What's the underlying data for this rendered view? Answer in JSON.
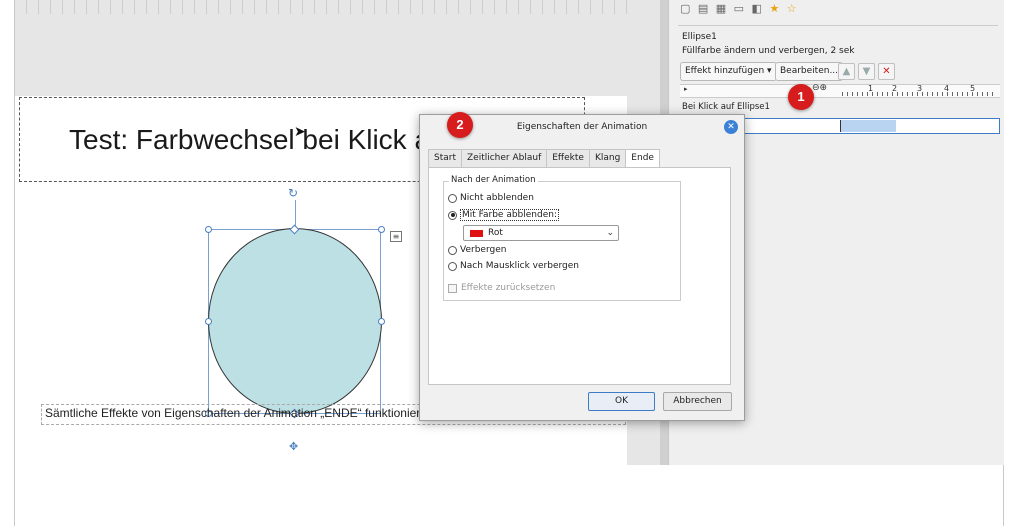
{
  "slide": {
    "title": "Test: Farbwechsel bei Klick auf Ellipse",
    "footer": "Sämtliche Effekte von Eigenschaften der Animation „ENDE“ funktionieren nicht"
  },
  "sidebar": {
    "shape_name": "Ellipse1",
    "effect_desc": "Füllfarbe ändern und verbergen, 2 sek",
    "add_effect_label": "Effekt hinzufügen ▾",
    "edit_label": "Bearbeiten...",
    "trigger_label": "Bei Klick auf Ellipse1",
    "timeline_ticks": [
      "1",
      "2",
      "3",
      "4",
      "5"
    ]
  },
  "badges": {
    "one": "1",
    "two": "2"
  },
  "dialog": {
    "title": "Eigenschaften der Animation",
    "tabs": [
      "Start",
      "Zeitlicher Ablauf",
      "Effekte",
      "Klang",
      "Ende"
    ],
    "active_tab": "Ende",
    "group_label": "Nach der Animation",
    "options": {
      "nicht_abblenden": "Nicht abblenden",
      "mit_farbe": "Mit Farbe abblenden:",
      "verbergen": "Verbergen",
      "mausklick": "Nach Mausklick verbergen"
    },
    "selected_option": "Mit Farbe abblenden:",
    "color_value": "Rot",
    "color_hex": "#e01010",
    "reset_label": "Effekte zurücksetzen",
    "ok_label": "OK",
    "cancel_label": "Abbrechen"
  },
  "colors": {
    "ellipse_fill": "#bce0e3",
    "badge_red": "#d61c1c",
    "accent_blue": "#3d7dc8"
  }
}
